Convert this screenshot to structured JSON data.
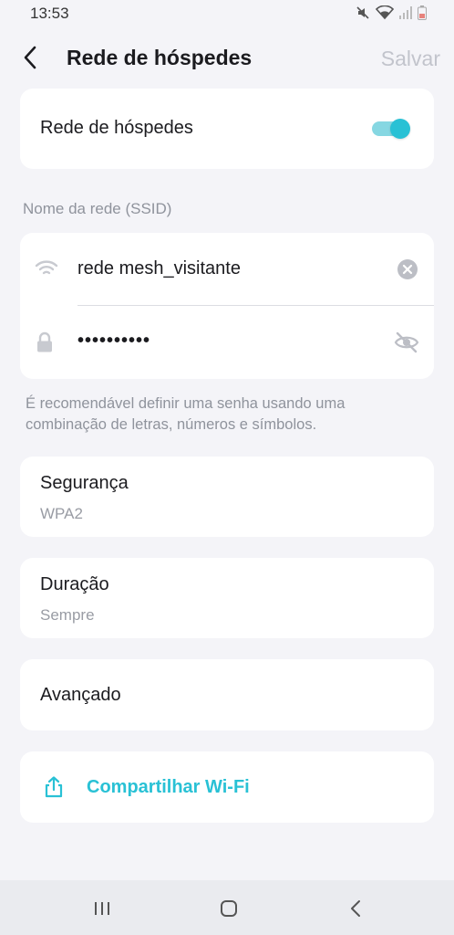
{
  "status_bar": {
    "time": "13:53",
    "icons": [
      "mute-icon",
      "wifi-icon",
      "signal-icon",
      "battery-icon"
    ]
  },
  "header": {
    "back_icon": "chevron-left-icon",
    "title": "Rede de hóspedes",
    "save_label": "Salvar"
  },
  "guest_network": {
    "label": "Rede de hóspedes",
    "enabled": true
  },
  "network": {
    "section_label": "Nome da rede (SSID)",
    "ssid_value": "rede mesh_visitante",
    "password_masked": "••••••••••",
    "ssid_icon": "wifi-icon",
    "password_icon": "lock-icon",
    "clear_icon": "clear-icon",
    "visibility_icon": "eye-off-icon"
  },
  "hint": "É recomendável definir uma senha usando uma combinação de letras, números e símbolos.",
  "security": {
    "title": "Segurança",
    "value": "WPA2"
  },
  "duration": {
    "title": "Duração",
    "value": "Sempre"
  },
  "advanced": {
    "title": "Avançado"
  },
  "share": {
    "icon": "share-icon",
    "label": "Compartilhar Wi-Fi"
  },
  "colors": {
    "accent": "#29c1d5",
    "background": "#f4f4f8",
    "card": "#ffffff",
    "muted_text": "#8f939c",
    "disabled_text": "#c2c4cc"
  },
  "nav_bar": {
    "buttons": [
      "recents-icon",
      "home-icon",
      "back-icon"
    ]
  }
}
